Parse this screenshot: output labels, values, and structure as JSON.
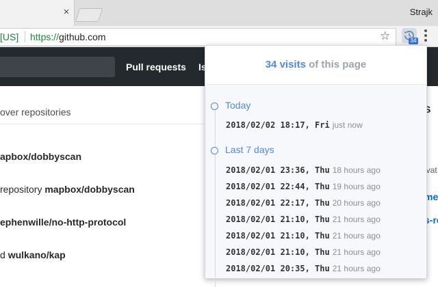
{
  "browser": {
    "tab_close_glyph": "×",
    "profile_name": "Strajk",
    "omnibox": {
      "cert": "[US]",
      "url_scheme": "https://",
      "url_host": "github.com"
    },
    "extension_badge": "34",
    "icons": [
      "close-icon",
      "new-tab-icon",
      "star-icon",
      "extension-icon",
      "menu-icon"
    ]
  },
  "github": {
    "nav": [
      "Pull requests",
      "Is"
    ],
    "rows": [
      {
        "text": "over repositories"
      },
      {
        "text": "apbox/dobbyscan"
      },
      {
        "prefix": "repository ",
        "bold": "mapbox/dobbyscan"
      },
      {
        "text": "ephenwille/no-http-protocol"
      },
      {
        "prefix": "d ",
        "bold": "wulkano/kap"
      }
    ],
    "right_peek": {
      "top_label": "S",
      "private_fragment": "ivat",
      "link1": "me",
      "link2": "s-re"
    }
  },
  "popup": {
    "count": "34 visits",
    "suffix": " of this page",
    "groups": [
      {
        "label": "Today",
        "visits": [
          {
            "datetime": "2018/02/02 18:17, Fri",
            "ago": "just now"
          }
        ]
      },
      {
        "label": "Last 7 days",
        "visits": [
          {
            "datetime": "2018/02/01 23:36, Thu",
            "ago": "18 hours ago"
          },
          {
            "datetime": "2018/02/01 22:44, Thu",
            "ago": "19 hours ago"
          },
          {
            "datetime": "2018/02/01 22:17, Thu",
            "ago": "20 hours ago"
          },
          {
            "datetime": "2018/02/01 21:10, Thu",
            "ago": "21 hours ago"
          },
          {
            "datetime": "2018/02/01 21:10, Thu",
            "ago": "21 hours ago"
          },
          {
            "datetime": "2018/02/01 21:10, Thu",
            "ago": "21 hours ago"
          },
          {
            "datetime": "2018/02/01 20:35, Thu",
            "ago": "21 hours ago"
          }
        ]
      }
    ]
  },
  "colors": {
    "accent": "#4d8ae0",
    "github_header": "#24292e",
    "secure_green": "#1b8a3a"
  }
}
